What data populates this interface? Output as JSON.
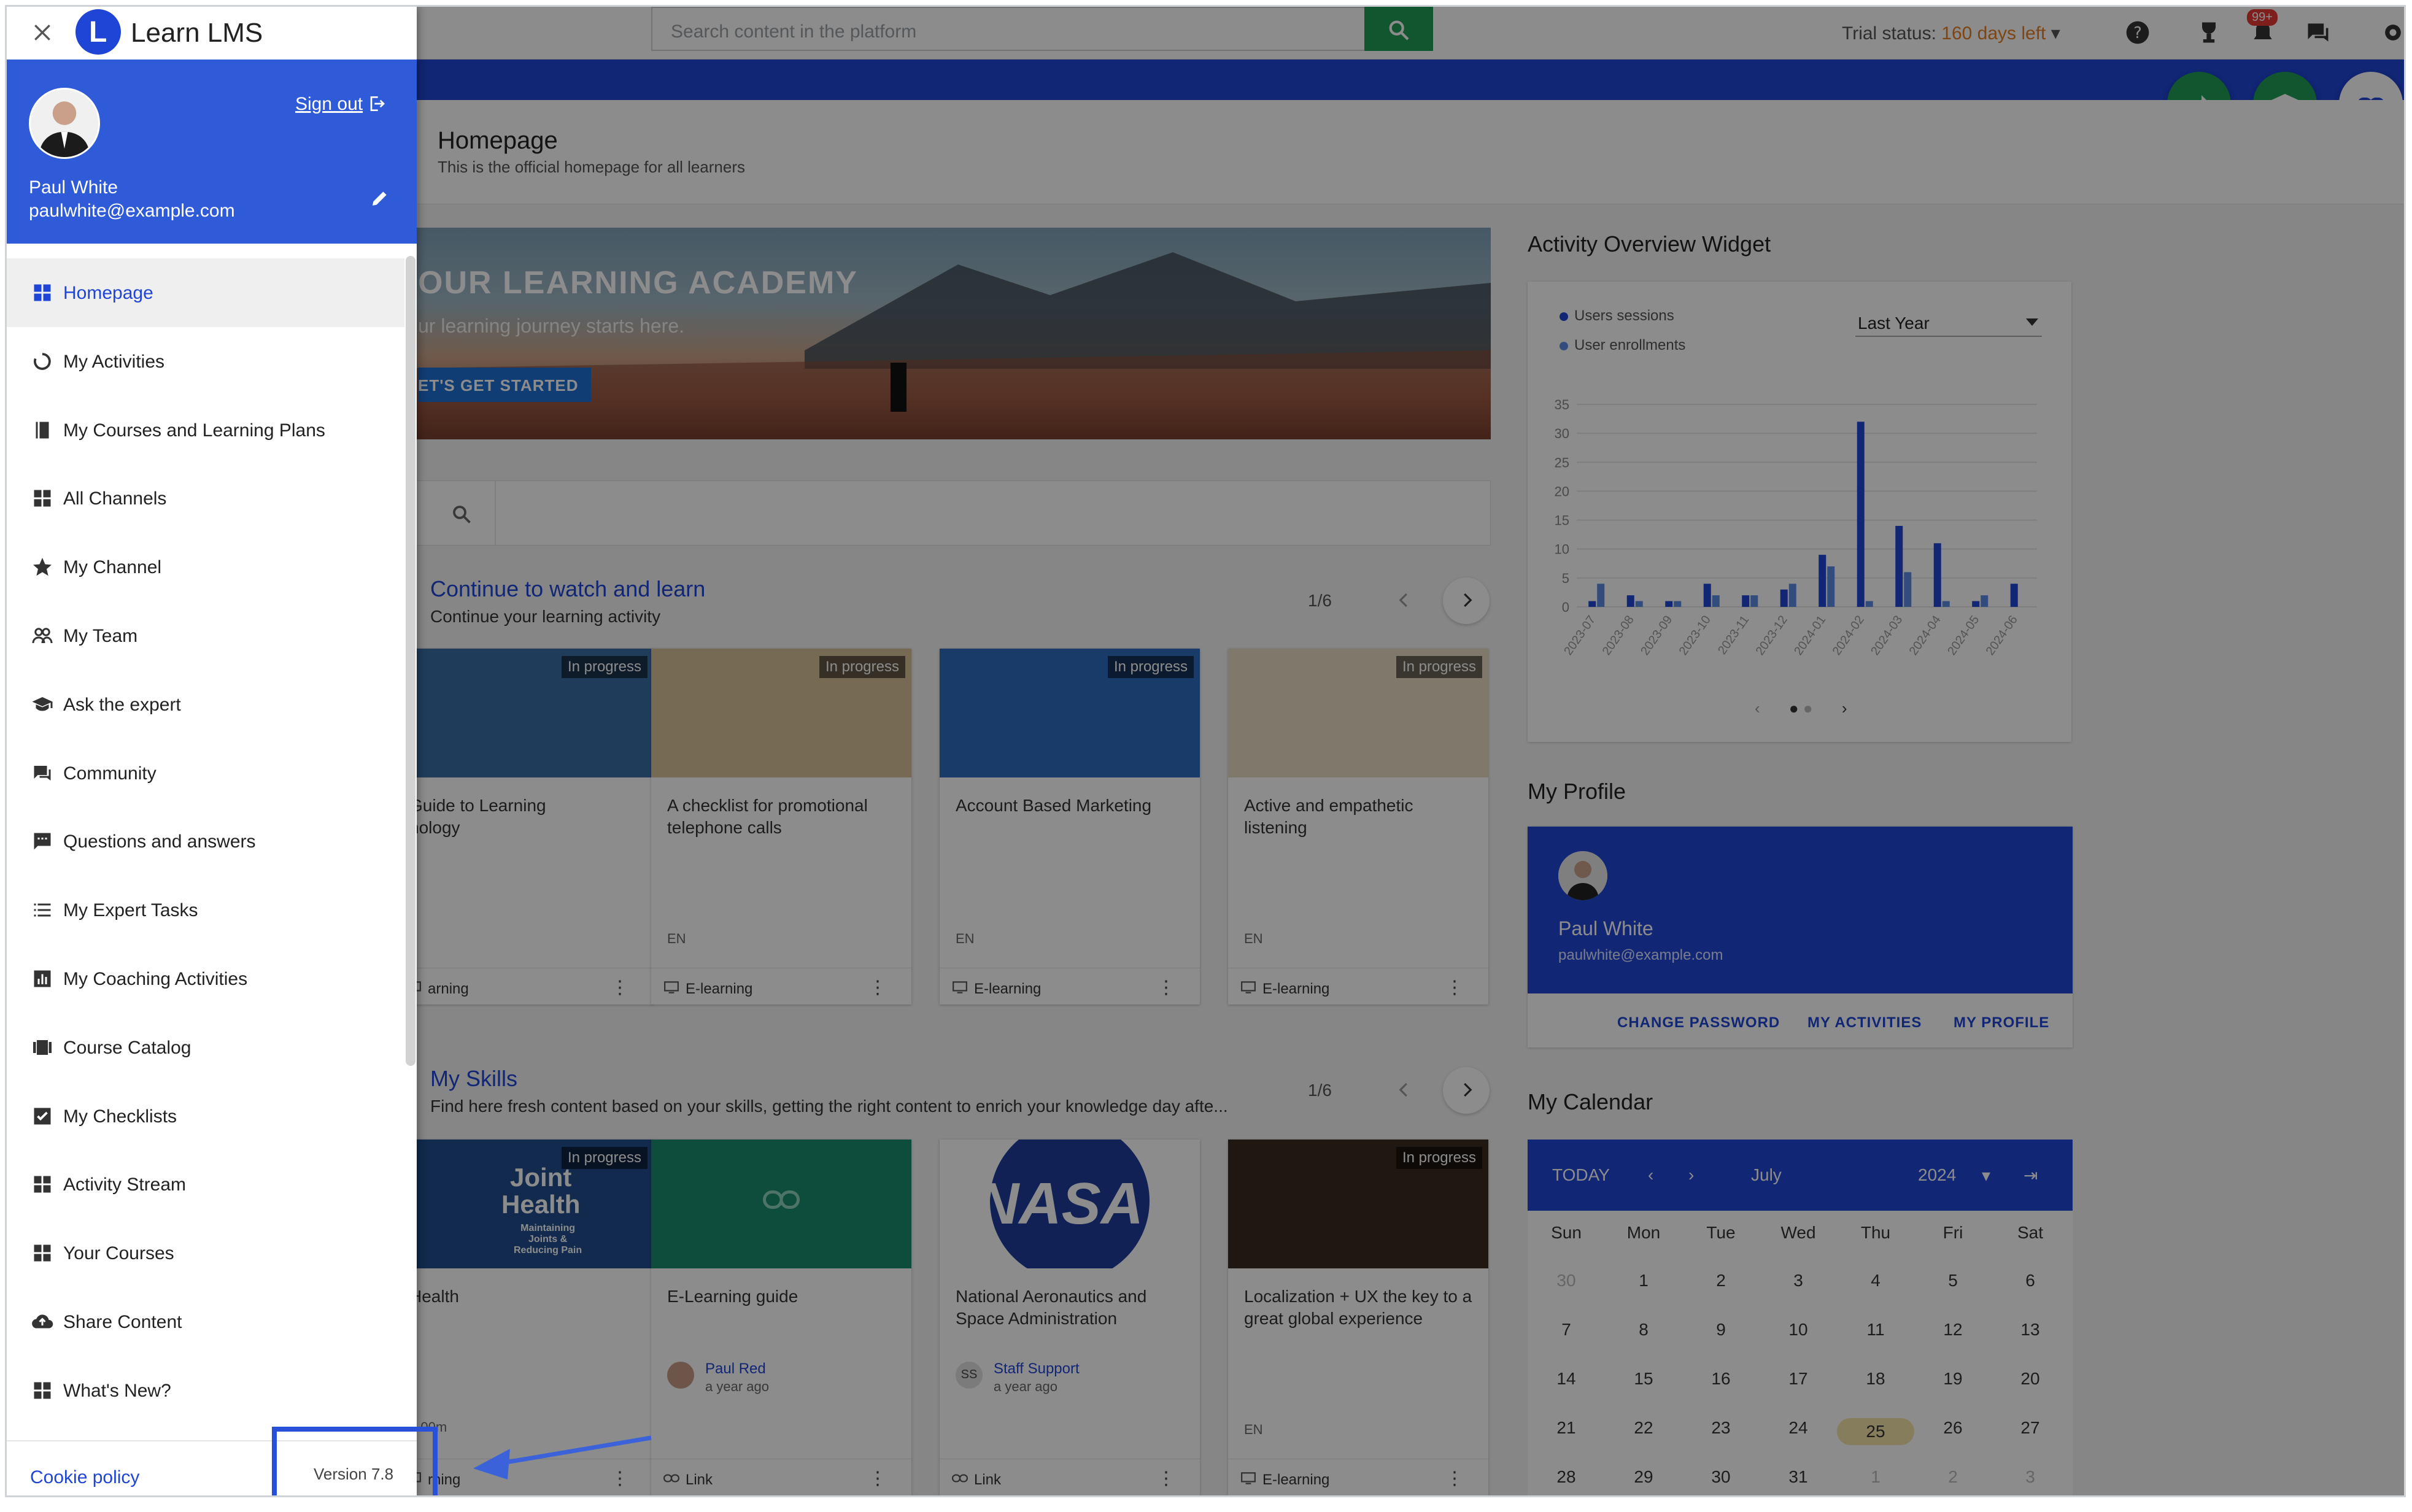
{
  "app": {
    "logo_letter": "L",
    "logo_text": "Learn LMS"
  },
  "topbar": {
    "search_placeholder": "Search content in the platform",
    "trial_label": "Trial status:",
    "trial_days": "160 days left",
    "notifications_badge": "99+"
  },
  "page": {
    "title": "Homepage",
    "subtitle": "This is the official homepage for all learners"
  },
  "hero": {
    "title": "OUR LEARNING ACADEMY",
    "subtitle": "ur learning journey starts here.",
    "button": "ET'S GET STARTED"
  },
  "continue_section": {
    "title": "Continue to watch and learn",
    "subtitle": "Continue your learning activity",
    "pager": "1/6",
    "cards": [
      {
        "title": "Guide to Learning\nnology",
        "tag": "In progress",
        "lang": "",
        "type": "arning",
        "thumb": "#3a6fa6"
      },
      {
        "title": "A checklist for promotional telephone calls",
        "tag": "In progress",
        "lang": "EN",
        "type": "E-learning",
        "thumb": "#d9c29a"
      },
      {
        "title": "Account Based Marketing",
        "tag": "In progress",
        "lang": "EN",
        "type": "E-learning",
        "thumb": "#2e6cbf"
      },
      {
        "title": "Active and empathetic listening",
        "tag": "In progress",
        "lang": "EN",
        "type": "E-learning",
        "thumb": "#e6dcc2"
      }
    ]
  },
  "skills_section": {
    "title": "My Skills",
    "subtitle": "Find here fresh content based on your skills, getting the right content to enrich your knowledge day afte...",
    "pager": "1/6",
    "cards": [
      {
        "title": "Health",
        "tag": "In progress",
        "thumb_text": "Joint\nHealth",
        "thumb_small": "Maintaining\nJoints &\nReducing Pain",
        "type": "rning",
        "duration": "h 00m"
      },
      {
        "title": "E-Learning guide",
        "author": "Paul Red",
        "ago": "a year ago",
        "type": "Link"
      },
      {
        "title": "National Aeronautics and Space Administration",
        "thumb_text": "NASA",
        "author": "Staff Support",
        "author_initials": "SS",
        "ago": "a year ago",
        "type": "Link"
      },
      {
        "title": "Localization + UX the key to a great global experience",
        "tag": "In progress",
        "lang": "EN",
        "type": "E-learning"
      }
    ]
  },
  "activity_widget": {
    "title": "Activity Overview Widget",
    "legend": [
      "Users sessions",
      "User enrollments"
    ],
    "period": "Last Year"
  },
  "chart_data": {
    "type": "bar",
    "categories": [
      "2023-07",
      "2023-08",
      "2023-09",
      "2023-10",
      "2023-11",
      "2023-12",
      "2024-01",
      "2024-02",
      "2024-03",
      "2024-04",
      "2024-05",
      "2024-06"
    ],
    "series": [
      {
        "name": "Users sessions",
        "values": [
          1,
          2,
          1,
          4,
          2,
          3,
          9,
          32,
          14,
          11,
          1,
          4
        ]
      },
      {
        "name": "User enrollments",
        "values": [
          4,
          1,
          1,
          2,
          2,
          4,
          7,
          1,
          6,
          1,
          2,
          0
        ]
      }
    ],
    "yticks": [
      "35",
      "30",
      "25",
      "20",
      "15",
      "10",
      "5",
      "0"
    ],
    "ylim": [
      0,
      35
    ],
    "grid": true,
    "legend": "top-left"
  },
  "my_profile": {
    "title": "My Profile",
    "name": "Paul White",
    "email": "paulwhite@example.com",
    "links": [
      "CHANGE PASSWORD",
      "MY ACTIVITIES",
      "MY PROFILE"
    ]
  },
  "calendar": {
    "title": "My Calendar",
    "today": "TODAY",
    "month": "July",
    "year": "2024",
    "weekdays": [
      "Sun",
      "Mon",
      "Tue",
      "Wed",
      "Thu",
      "Fri",
      "Sat"
    ],
    "weeks": [
      [
        "30",
        "1",
        "2",
        "3",
        "4",
        "5",
        "6"
      ],
      [
        "7",
        "8",
        "9",
        "10",
        "11",
        "12",
        "13"
      ],
      [
        "14",
        "15",
        "16",
        "17",
        "18",
        "19",
        "20"
      ],
      [
        "21",
        "22",
        "23",
        "24",
        "25",
        "26",
        "27"
      ],
      [
        "28",
        "29",
        "30",
        "31",
        "1",
        "2",
        "3"
      ]
    ],
    "highlight": "25"
  },
  "drawer": {
    "user": {
      "name": "Paul White",
      "email": "paulwhite@example.com",
      "sign_out": "Sign out"
    },
    "nav": [
      {
        "label": "Homepage",
        "icon": "grid",
        "active": true
      },
      {
        "label": "My Activities",
        "icon": "refresh"
      },
      {
        "label": "My Courses and Learning Plans",
        "icon": "book"
      },
      {
        "label": "All Channels",
        "icon": "grid"
      },
      {
        "label": "My Channel",
        "icon": "star"
      },
      {
        "label": "My Team",
        "icon": "people"
      },
      {
        "label": "Ask the expert",
        "icon": "mortarboard"
      },
      {
        "label": "Community",
        "icon": "chat"
      },
      {
        "label": "Questions and answers",
        "icon": "comment"
      },
      {
        "label": "My Expert Tasks",
        "icon": "list"
      },
      {
        "label": "My Coaching Activities",
        "icon": "chart"
      },
      {
        "label": "Course Catalog",
        "icon": "catalog"
      },
      {
        "label": "My Checklists",
        "icon": "checkbox"
      },
      {
        "label": "Activity Stream",
        "icon": "grid"
      },
      {
        "label": "Your Courses",
        "icon": "grid"
      },
      {
        "label": "Share Content",
        "icon": "cloud-upload"
      },
      {
        "label": "What's New?",
        "icon": "grid"
      }
    ],
    "cookie_policy": "Cookie policy",
    "version": "Version 7.8"
  },
  "colors": {
    "brand_blue": "#1f45d6",
    "accent_green": "#1f9d55",
    "trial_orange": "#e67e22"
  }
}
